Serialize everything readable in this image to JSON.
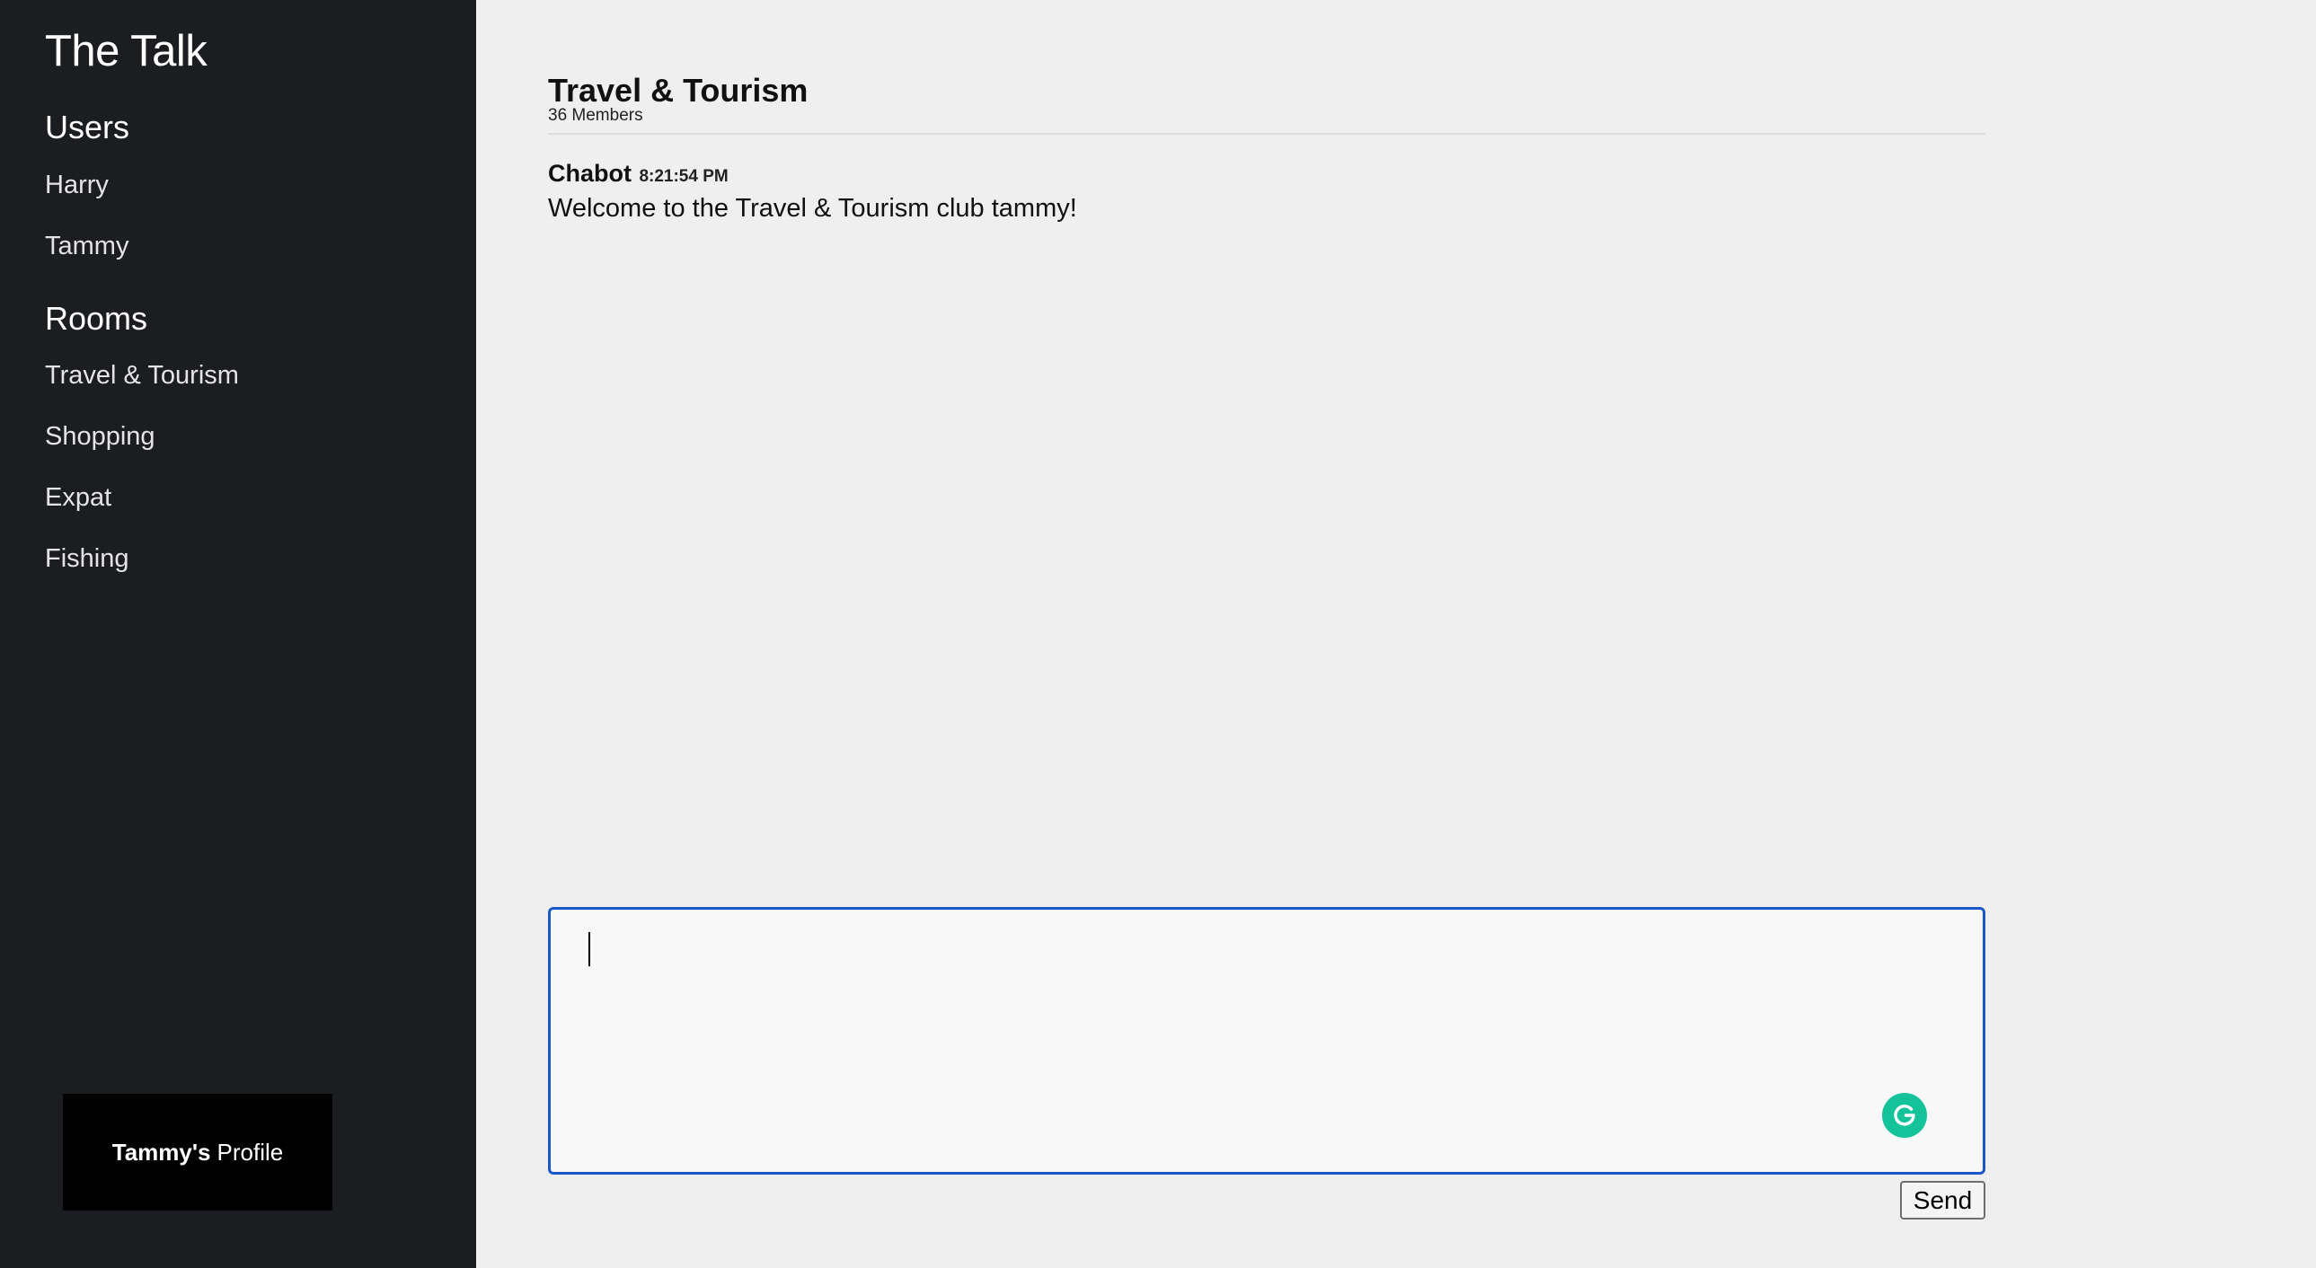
{
  "sidebar": {
    "app_title": "The Talk",
    "users_heading": "Users",
    "users": [
      {
        "label": "Harry"
      },
      {
        "label": "Tammy"
      }
    ],
    "rooms_heading": "Rooms",
    "rooms": [
      {
        "label": "Travel & Tourism"
      },
      {
        "label": "Shopping"
      },
      {
        "label": "Expat"
      },
      {
        "label": "Fishing"
      }
    ],
    "profile": {
      "name": "Tammy's",
      "suffix": "Profile"
    }
  },
  "room": {
    "title": "Travel & Tourism",
    "members": "36 Members"
  },
  "messages": [
    {
      "author": "Chabot",
      "time": "8:21:54 PM",
      "text": "Welcome to the Travel & Tourism club tammy!"
    }
  ],
  "composer": {
    "value": "",
    "send_label": "Send",
    "accent_color": "#1a58c8",
    "grammarly_color": "#15c39a"
  },
  "icons": [
    "grammarly-icon"
  ]
}
